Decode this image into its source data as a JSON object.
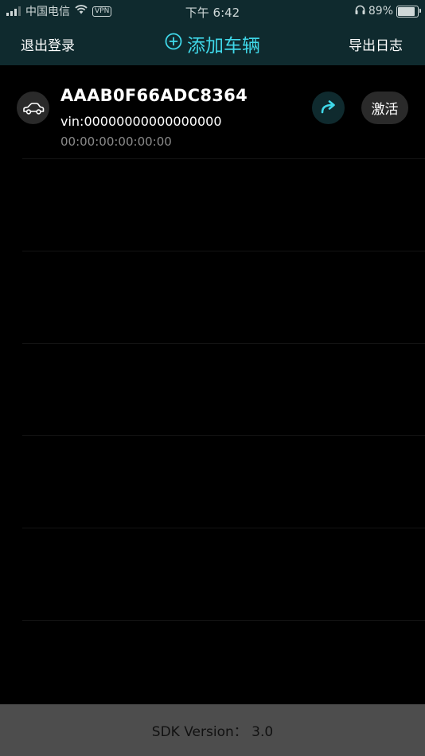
{
  "status_bar": {
    "carrier": "中国电信",
    "vpn": "VPN",
    "time": "下午 6:42",
    "battery_text": "89%",
    "battery_level": 0.89,
    "icons": [
      "signal-icon",
      "wifi-icon",
      "headphones-icon",
      "battery-icon"
    ]
  },
  "nav": {
    "logout_label": "退出登录",
    "add_vehicle_label": "添加车辆",
    "export_log_label": "导出日志",
    "accent_color": "#3fd7e8"
  },
  "vehicles": [
    {
      "device_id": "AAAB0F66ADC8364",
      "vin": "vin:00000000000000000",
      "mac": "00:00:00:00:00:00",
      "activate_label": "激活",
      "icons": [
        "car-icon",
        "share-arrow-icon"
      ]
    }
  ],
  "footer": {
    "sdk_version": "SDK Version：  3.0"
  }
}
